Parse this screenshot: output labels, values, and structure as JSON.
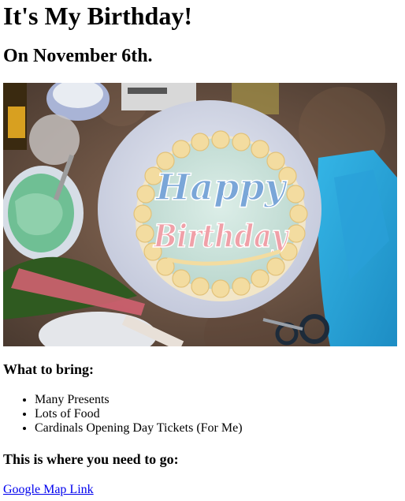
{
  "header": {
    "title": "It's My Birthday!",
    "subtitle": "On November 6th."
  },
  "photo": {
    "alt": "Birthday cake with Happy Birthday written in frosting",
    "cake_text_line1": "Happy",
    "cake_text_line2": "Birthday"
  },
  "bring": {
    "heading": "What to bring:",
    "items": [
      {
        "label": "Many Presents"
      },
      {
        "label": "Lots of Food"
      },
      {
        "label": "Cardinals Opening Day Tickets (For Me)"
      }
    ]
  },
  "location": {
    "heading": "This is where you need to go:",
    "link_text": "Google Map Link"
  },
  "colors": {
    "link": "#0000EE",
    "frosting": "#cfe3dc",
    "border_icing": "#f3dca0",
    "blue_letters": "#7aa6d8",
    "pink_letters": "#f0a0a8"
  }
}
